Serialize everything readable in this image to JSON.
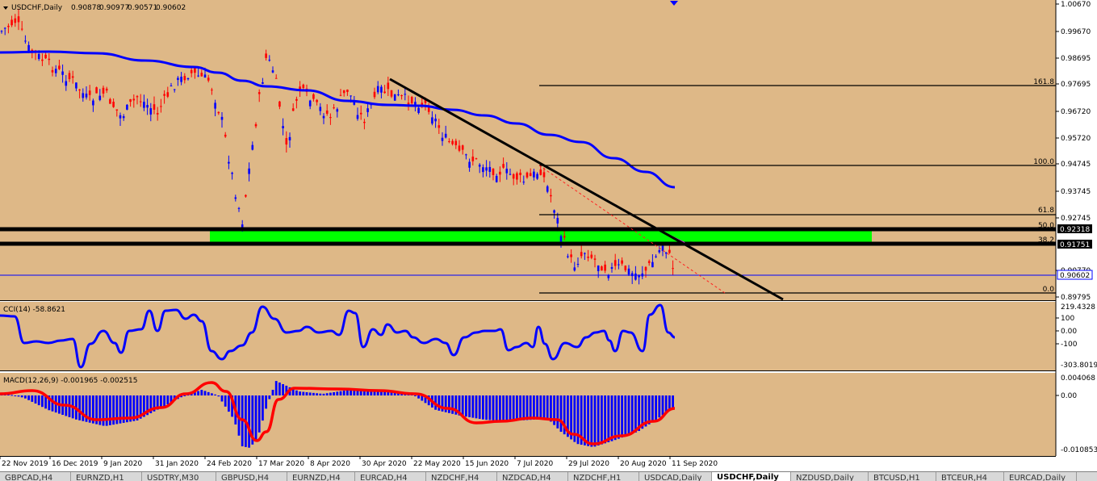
{
  "main_chart": {
    "symbol_label": "USDCHF,Daily",
    "ohlc": [
      "0.90878",
      "0.90977",
      "0.90571",
      "0.90602"
    ],
    "price_ticks": [
      "1.00670",
      "0.99670",
      "0.98695",
      "0.97695",
      "0.96720",
      "0.95720",
      "0.94745",
      "0.93745",
      "0.92745",
      "0.90770",
      "0.89795"
    ],
    "price_markers": [
      {
        "label": "0.92318",
        "style": "black"
      },
      {
        "label": "0.91751",
        "style": "black"
      },
      {
        "label": "0.90602",
        "style": "blue"
      }
    ],
    "fib_levels": [
      "161.8",
      "100.0",
      "61.8",
      "50.0",
      "38.2",
      "0.0"
    ],
    "date_labels": [
      "22 Nov 2019",
      "16 Dec 2019",
      "9 Jan 2020",
      "31 Jan 2020",
      "24 Feb 2020",
      "17 Mar 2020",
      "8 Apr 2020",
      "30 Apr 2020",
      "22 May 2020",
      "15 Jun 2020",
      "7 Jul 2020",
      "29 Jul 2020",
      "20 Aug 2020",
      "11 Sep 2020"
    ]
  },
  "cci_panel": {
    "label": "CCI(14) -58.8621",
    "ticks": [
      "219.4328",
      "100",
      "0.00",
      "-100",
      "-303.8019"
    ]
  },
  "macd_panel": {
    "label": "MACD(12,26,9) -0.001965 -0.002515",
    "ticks": [
      "0.004068",
      "0.00",
      "-0.010853"
    ]
  },
  "colors": {
    "background": "#deb887",
    "bull_candle": "#0000ff",
    "bear_candle": "#ff0000",
    "moving_average": "#0000ff",
    "support_zone": "#00ff00",
    "trendline": "#000000"
  },
  "tabs": [
    {
      "label": "GBPCAD,H4",
      "active": false
    },
    {
      "label": "EURNZD,H1",
      "active": false
    },
    {
      "label": "USDTRY,M30",
      "active": false
    },
    {
      "label": "GBPUSD,H4",
      "active": false
    },
    {
      "label": "EURNZD,H4",
      "active": false
    },
    {
      "label": "EURCAD,H4",
      "active": false
    },
    {
      "label": "NZDCHF,H4",
      "active": false
    },
    {
      "label": "NZDCAD,H4",
      "active": false
    },
    {
      "label": "NZDCHF,H1",
      "active": false
    },
    {
      "label": "USDCAD,Daily",
      "active": false
    },
    {
      "label": "USDCHF,Daily",
      "active": true
    },
    {
      "label": "NZDUSD,Daily",
      "active": false
    },
    {
      "label": "BTCUSD,H1",
      "active": false
    },
    {
      "label": "BTCEUR,H4",
      "active": false
    },
    {
      "label": "EURCAD,Daily",
      "active": false
    }
  ]
}
